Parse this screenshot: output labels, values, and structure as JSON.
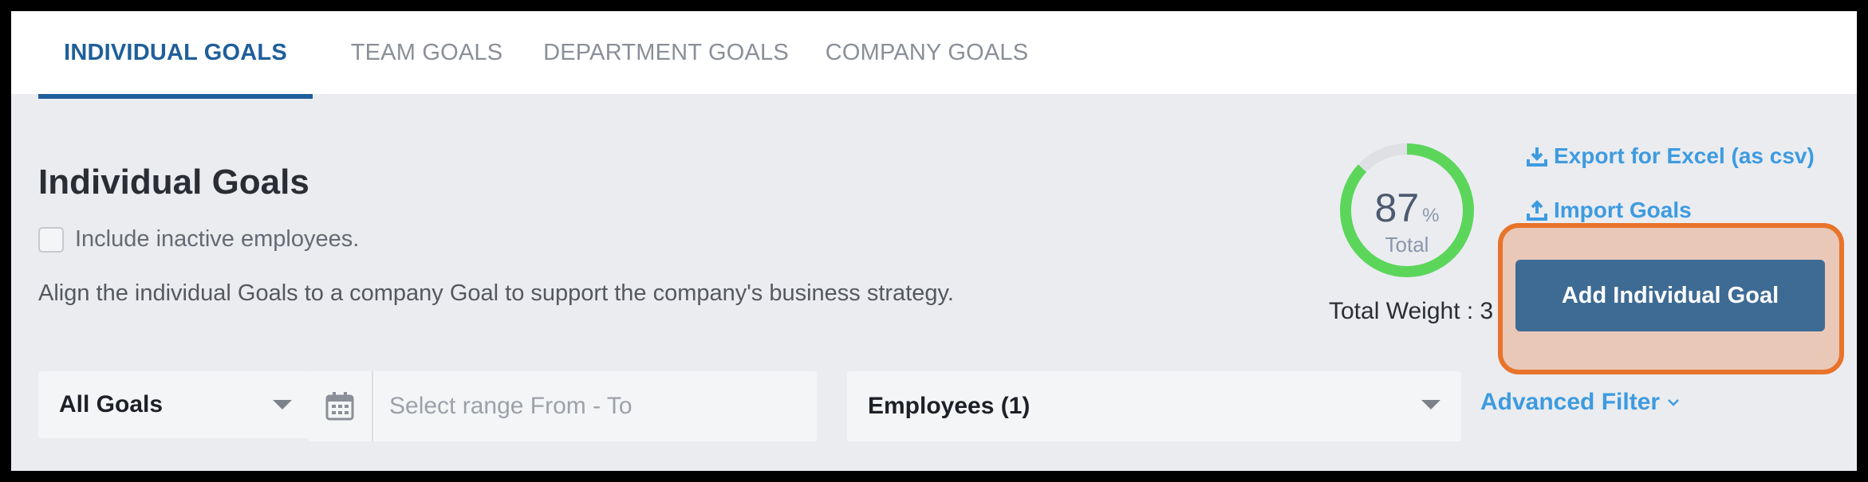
{
  "tabs": [
    {
      "label": "INDIVIDUAL GOALS",
      "active": true
    },
    {
      "label": "TEAM GOALS",
      "active": false
    },
    {
      "label": "DEPARTMENT GOALS",
      "active": false
    },
    {
      "label": "COMPANY GOALS",
      "active": false
    }
  ],
  "header": {
    "title": "Individual Goals",
    "include_inactive_label": "Include inactive employees.",
    "description": "Align the individual Goals to a company Goal to support the company's business strategy."
  },
  "summary": {
    "percent_value": "87",
    "percent_sign": "%",
    "percent_fraction": 0.87,
    "total_label": "Total",
    "total_weight_text": "Total Weight : 3"
  },
  "actions": {
    "export_label": "Export for Excel (as csv)",
    "import_label": "Import Goals",
    "add_button_label": "Add Individual Goal"
  },
  "filters": {
    "goals_select_value": "All Goals",
    "date_placeholder": "Select range From - To",
    "employees_select_value": "Employees (1)",
    "advanced_filter_label": "Advanced Filter"
  },
  "colors": {
    "accent_blue": "#1f5f9a",
    "link_blue": "#3d9be0",
    "button_blue": "#3e6b94",
    "donut_green": "#5bd65b",
    "highlight_orange": "#e8732a"
  },
  "icons": {
    "export": "download-icon",
    "import": "upload-icon",
    "calendar": "calendar-icon",
    "dropdown": "caret-down-icon",
    "advanced": "chevron-down-icon"
  }
}
